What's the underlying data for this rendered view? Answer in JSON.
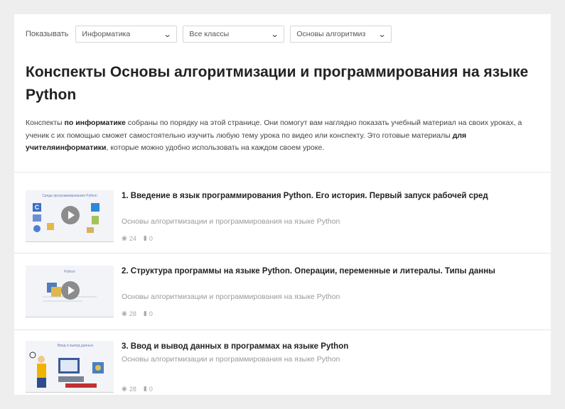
{
  "filters": {
    "show_label": "Показывать",
    "subject": "Информатика",
    "grade": "Все классы",
    "topic": "Основы алгоритмиз"
  },
  "page": {
    "title": "Конспекты Основы алгоритмизации и программирования на языке Python",
    "intro": {
      "p1": "Конспекты ",
      "b1": "по информатике",
      "p2": " собраны по порядку на этой странице. Они помогут вам наглядно показать учебный материал на своих уроках, а ученик с их помощью сможет самостоятельно изучить любую тему урока по видео или конспекту. Это готовые материалы ",
      "b2": "для учителяинформатики",
      "p3": ", которые можно удобно использовать на каждом своем уроке."
    }
  },
  "lessons": [
    {
      "title": "1. Введение в язык программирования Python. Его история. Первый запуск рабочей сред",
      "category": "Основы алгоритмизации и программирования на языке Python",
      "views": "24",
      "comments": "0",
      "thumb_caption": "Среда программирования Python"
    },
    {
      "title": "2. Структура программы на языке Python. Операции, переменные и литералы. Типы данны",
      "category": "Основы алгоритмизации и программирования на языке Python",
      "views": "28",
      "comments": "0",
      "thumb_caption": "Python"
    },
    {
      "title": "3. Ввод и вывод данных в программах на языке Python",
      "category": "Основы алгоритмизации и программирования на языке Python",
      "views": "28",
      "comments": "0",
      "thumb_caption": "Ввод и вывод данных"
    }
  ],
  "icons": {
    "dropdown": "chevron-down-icon",
    "views": "eye-icon",
    "comments": "comment-icon",
    "play": "play-icon"
  },
  "colors": {
    "background": "#eeeeee",
    "card": "#ffffff",
    "muted_text": "#9a9a9a"
  }
}
